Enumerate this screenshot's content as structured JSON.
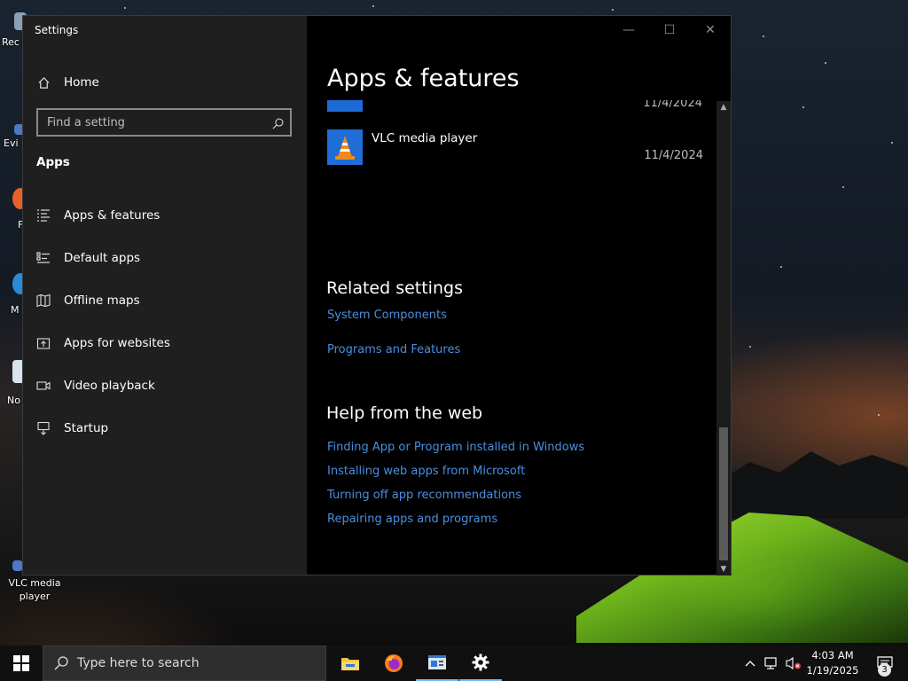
{
  "desktop": {
    "icons": [
      {
        "label": "Rec"
      },
      {
        "label": "Evi"
      },
      {
        "label": "F"
      },
      {
        "label": "M"
      },
      {
        "label": "No"
      },
      {
        "label": "VLC media player"
      }
    ]
  },
  "window": {
    "title": "Settings",
    "controls": {
      "minimize": "—",
      "maximize": "☐",
      "close": "✕"
    }
  },
  "sidebar": {
    "home_label": "Home",
    "search": {
      "placeholder": "Find a setting"
    },
    "section_title": "Apps",
    "items": [
      {
        "label": "Apps & features",
        "icon": "apps-features-icon"
      },
      {
        "label": "Default apps",
        "icon": "default-apps-icon"
      },
      {
        "label": "Offline maps",
        "icon": "offline-maps-icon"
      },
      {
        "label": "Apps for websites",
        "icon": "apps-websites-icon"
      },
      {
        "label": "Video playback",
        "icon": "video-playback-icon"
      },
      {
        "label": "Startup",
        "icon": "startup-icon"
      }
    ]
  },
  "main": {
    "title": "Apps & features",
    "partial_app": {
      "date": "11/4/2024"
    },
    "apps": [
      {
        "name": "VLC media player",
        "date": "11/4/2024",
        "icon": "vlc-icon"
      }
    ],
    "related": {
      "title": "Related settings",
      "links": [
        "System Components",
        "Programs and Features"
      ]
    },
    "help": {
      "title": "Help from the web",
      "links": [
        "Finding App or Program installed in Windows",
        "Installing web apps from Microsoft",
        "Turning off app recommendations",
        "Repairing apps and programs"
      ]
    }
  },
  "taskbar": {
    "search_placeholder": "Type here to search",
    "apps": [
      "file-explorer-icon",
      "firefox-icon",
      "app-window-icon",
      "settings-gear-icon"
    ],
    "time": "4:03 AM",
    "date": "1/19/2025",
    "notification_count": "3",
    "accent": "#76b9ed"
  },
  "colors": {
    "link": "#4a8ee0",
    "sidebar_bg": "#1f1f1f",
    "main_bg": "#000000"
  }
}
